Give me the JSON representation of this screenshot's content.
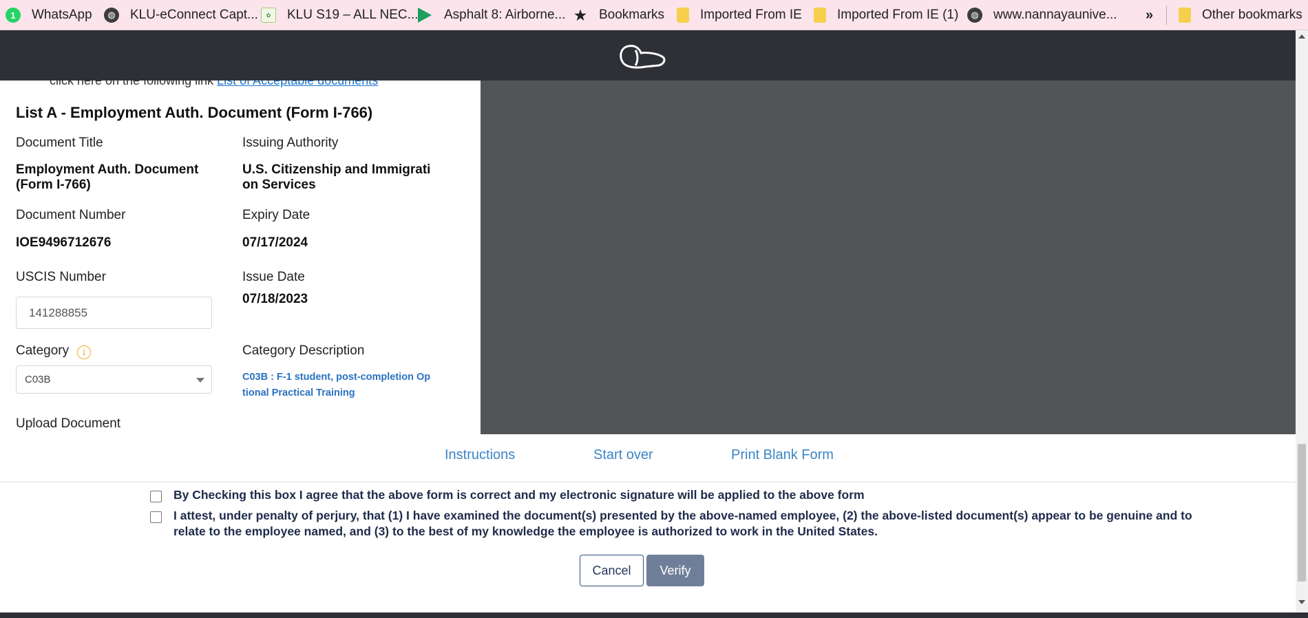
{
  "bookmarks": {
    "items": [
      {
        "label": "WhatsApp",
        "icon": "whatsapp-icon"
      },
      {
        "label": "KLU-eConnect Capt...",
        "icon": "globe-icon"
      },
      {
        "label": "KLU S19 – ALL NEC...",
        "icon": "klu-icon"
      },
      {
        "label": "Asphalt 8: Airborne...",
        "icon": "play-store-icon"
      },
      {
        "label": "Bookmarks",
        "icon": "star-icon"
      },
      {
        "label": "Imported From IE",
        "icon": "folder-icon"
      },
      {
        "label": "Imported From IE (1)",
        "icon": "folder-icon"
      },
      {
        "label": "www.nannayaunive...",
        "icon": "globe-icon"
      }
    ],
    "more": "»",
    "other": "Other bookmarks"
  },
  "form": {
    "clipped_prefix": "click here on the following link",
    "clipped_link": "List of Acceptable documents",
    "section_title": "List A - Employment Auth. Document (Form I-766)",
    "document_title_label": "Document Title",
    "document_title_value": "Employment Auth. Document (Form I-766)",
    "issuing_authority_label": "Issuing Authority",
    "issuing_authority_value": "U.S. Citizenship and Immigrati on Services",
    "document_number_label": "Document Number",
    "document_number_value": "IOE9496712676",
    "expiry_date_label": "Expiry Date",
    "expiry_date_value": "07/17/2024",
    "uscis_number_label": "USCIS Number",
    "uscis_number_value": "141288855",
    "issue_date_label": "Issue Date",
    "issue_date_value": "07/18/2023",
    "category_label": "Category",
    "category_value": "C03B",
    "category_description_label": "Category Description",
    "category_description_value": "C03B : F-1 student, post-completion Op tional Practical Training",
    "upload_label": "Upload Document"
  },
  "links": {
    "instructions": "Instructions",
    "start_over": "Start over",
    "print_blank_form": "Print Blank Form"
  },
  "agreement": {
    "signature_text": "By Checking this box I agree that the above form is correct and my electronic signature will be applied to the above form",
    "attest_text": "I attest, under penalty of perjury, that (1) I have examined the document(s) presented by the above-named employee, (2) the above-listed document(s) appear to be genuine and to relate to the employee named, and (3) to the best of my knowledge the employee is authorized to work in the United States."
  },
  "buttons": {
    "cancel": "Cancel",
    "verify": "Verify"
  },
  "colors": {
    "header_bg": "#2e3036",
    "preview_bg": "#525558",
    "link": "#3b84c7",
    "verify_bg": "#6f7f99",
    "bookmarks_bg": "#fbe4ec"
  }
}
